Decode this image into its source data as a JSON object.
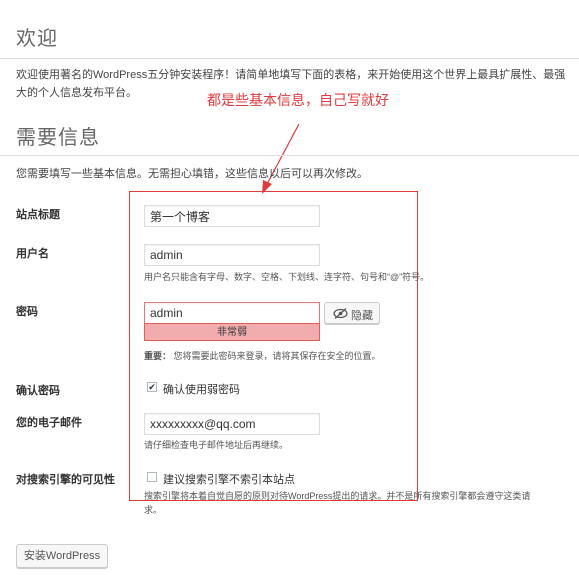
{
  "welcome": {
    "title": "欢迎",
    "intro_line1": "欢迎使用著名的WordPress五分钟安装程序！请简单地填写下面的表格，来开始使用这个世界上最具扩展性、最强",
    "intro_line2": "大的个人信息发布平台。"
  },
  "annotation": {
    "text": "都是些基本信息，自己写就好",
    "color": "#e4393c"
  },
  "info": {
    "title": "需要信息",
    "description": "您需要填写一些基本信息。无需担心填错，这些信息以后可以再次修改。"
  },
  "form": {
    "site_title": {
      "label": "站点标题",
      "value": "第一个博客"
    },
    "username": {
      "label": "用户名",
      "value": "admin",
      "hint": "用户名只能含有字母、数字、空格、下划线、连字符、句号和“@”符号。"
    },
    "password": {
      "label": "密码",
      "value": "admin",
      "strength": "非常弱",
      "hide_button": "隐藏",
      "note_bold": "重要：",
      "note": "您将需要此密码来登录，请将其保存在安全的位置。"
    },
    "confirm_password": {
      "label": "确认密码",
      "checkbox_label": "确认使用弱密码",
      "checked": true
    },
    "email": {
      "label": "您的电子邮件",
      "value": "xxxxxxxxx@qq.com",
      "hint": "请仔细检查电子邮件地址后再继续。"
    },
    "search_visibility": {
      "label": "对搜索引擎的可见性",
      "checkbox_label": "建议搜索引擎不索引本站点",
      "checked": false,
      "note_line1": "搜索引擎将本着自觉自愿的原则对待WordPress提出的请求。并不是所有搜索引擎都会遵守这类请",
      "note_line2": "求。"
    },
    "install_button": "安装WordPress"
  },
  "colors": {
    "annotation_red": "#e4393c",
    "weak_strength_bg": "#f1adad",
    "weak_strength_border": "#e35b5b"
  }
}
